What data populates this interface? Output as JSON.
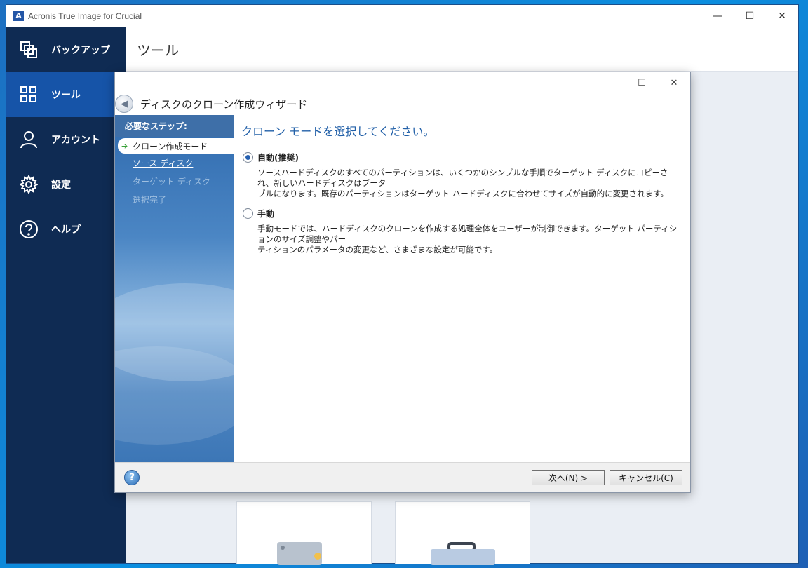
{
  "app": {
    "title": "Acronis True Image for Crucial",
    "logo_letter": "A",
    "controls": [
      "—",
      "☐",
      "✕"
    ]
  },
  "sidebar": {
    "items": [
      {
        "label": "バックアップ",
        "icon": "copy-icon"
      },
      {
        "label": "ツール",
        "icon": "grid-icon",
        "active": true
      },
      {
        "label": "アカウント",
        "icon": "user-icon"
      },
      {
        "label": "設定",
        "icon": "gear-icon"
      },
      {
        "label": "ヘルプ",
        "icon": "question-icon"
      }
    ]
  },
  "main": {
    "title": "ツール"
  },
  "wizard": {
    "title": "ディスクのクローン作成ウィザード",
    "controls": [
      "—",
      "☐",
      "✕"
    ],
    "steps_heading": "必要なステップ:",
    "steps": [
      {
        "label": "クローン作成モード",
        "state": "current"
      },
      {
        "label": "ソース ディスク",
        "state": "link"
      },
      {
        "label": "ターゲット ディスク",
        "state": "disabled"
      },
      {
        "label": "選択完了",
        "state": "disabled"
      }
    ],
    "prompt": "クローン モードを選択してください。",
    "options": [
      {
        "label": "自動(推奨)",
        "checked": true,
        "description_lines": [
          "ソースハードディスクのすべてのパーティションは、いくつかのシンプルな手順でターゲット ディスクにコピーされ、新しいハードディスクはブータ",
          "ブルになります。既存のパーティションはターゲット ハードディスクに合わせてサイズが自動的に変更されます。"
        ]
      },
      {
        "label": "手動",
        "checked": false,
        "description_lines": [
          "手動モードでは、ハードディスクのクローンを作成する処理全体をユーザーが制御できます。ターゲット パーティションのサイズ調整やパー",
          "ティションのパラメータの変更など、さまざまな設定が可能です。"
        ]
      }
    ],
    "help_label": "?",
    "next_label": "次へ(N) >",
    "cancel_label": "キャンセル(C)"
  },
  "colors": {
    "sidebar_bg": "#0f2b53",
    "sidebar_active": "#1654a8",
    "accent": "#2260a8",
    "desktop": "#0b8fe0"
  }
}
